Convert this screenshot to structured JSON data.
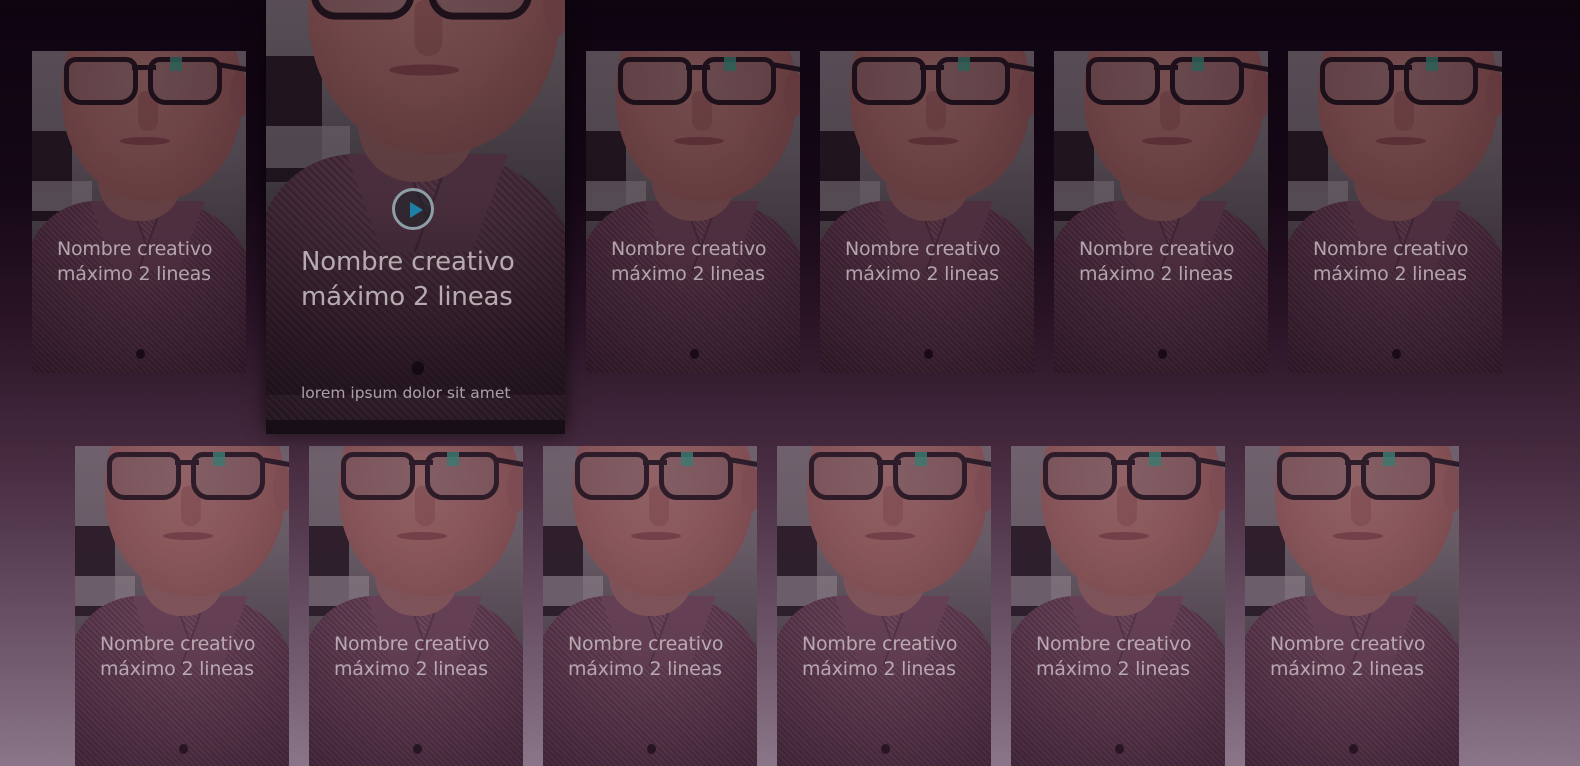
{
  "cards": [
    {
      "title": "Nombre creativo máximo 2 lineas"
    },
    {
      "title": "Nombre creativo máximo 2 lineas",
      "subtitle": "lorem ipsum dolor sit amet",
      "play_icon": "play-icon"
    },
    {
      "title": "Nombre creativo máximo 2 lineas"
    },
    {
      "title": "Nombre creativo máximo 2 lineas"
    },
    {
      "title": "Nombre creativo máximo 2 lineas"
    },
    {
      "title": "Nombre creativo máximo 2 lineas"
    },
    {
      "title": "Nombre creativo máximo 2 lineas"
    },
    {
      "title": "Nombre creativo máximo 2 lineas"
    },
    {
      "title": "Nombre creativo máximo 2 lineas"
    },
    {
      "title": "Nombre creativo máximo 2 lineas"
    },
    {
      "title": "Nombre creativo máximo 2 lineas"
    },
    {
      "title": "Nombre creativo máximo 2 lineas"
    }
  ],
  "colors": {
    "background_top": "#0e0410",
    "background_bottom": "#8a7589",
    "play_ring": "#8e9ea6",
    "play_triangle": "#1c7fa3"
  }
}
